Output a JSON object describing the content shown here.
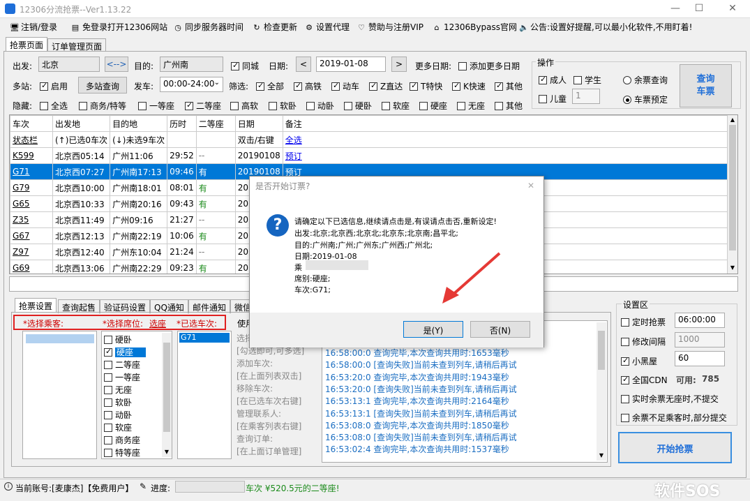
{
  "window": {
    "title": "12306分流抢票--Ver1.13.22",
    "minimize": "—",
    "maximize": "☐",
    "close": "✕"
  },
  "menu": [
    {
      "icon": "🖥",
      "label": "注销/登录"
    },
    {
      "icon": "▤",
      "label": "免登录打开12306网站"
    },
    {
      "icon": "◷",
      "label": "同步服务器时间"
    },
    {
      "icon": "↻",
      "label": "检查更新"
    },
    {
      "icon": "⚙",
      "label": "设置代理"
    },
    {
      "icon": "♡",
      "label": "赞助与注册VIP"
    },
    {
      "icon": "⌂",
      "label": "12306Bypass官网"
    },
    {
      "icon": "🔈",
      "label": "公告:设置好提醒,可以最小化软件,不用盯着!"
    }
  ],
  "tabs": {
    "main": "抢票页面",
    "orders": "订单管理页面"
  },
  "query": {
    "from_label": "出发:",
    "from_value": "北京",
    "swap": "<-->",
    "to_label": "目的:",
    "to_value": "广州南",
    "same_city": "同城",
    "date_label": "日期:",
    "date_value": "2019-01-08",
    "prev": "<",
    "next": ">",
    "more_dates_label": "更多日期:",
    "add_dates": "添加更多日期",
    "multi_label": "多站:",
    "enable": "启用",
    "multi_query": "多站查询",
    "depart_label": "发车:",
    "depart_value": "00:00-24:00",
    "filter_label": "筛选:",
    "filters": [
      "全部",
      "高铁",
      "动车",
      "Z直达",
      "T特快",
      "K快速",
      "其他"
    ],
    "hide_label": "隐藏:",
    "hides": [
      "全选",
      "商务/特等",
      "一等座",
      "二等座",
      "高软",
      "软卧",
      "动卧",
      "硬卧",
      "软座",
      "硬座",
      "无座",
      "其他"
    ]
  },
  "ops": {
    "title": "操作",
    "adult": "成人",
    "student": "学生",
    "child": "儿童",
    "child_count": "1",
    "remain_query": "余票查询",
    "ticket_book": "车票预定",
    "query_btn": "查询\n车票"
  },
  "grid": {
    "headers": [
      "车次",
      "出发地",
      "目的地",
      "历时",
      "二等座",
      "日期",
      "备注"
    ],
    "subheaders": [
      "状态栏",
      "(↑)已选0车次",
      "(↓)未选9车次",
      "",
      "",
      "双击/右键",
      "全选"
    ],
    "rows": [
      {
        "train": "K599",
        "from": "北京西05:14",
        "to": "广州11:06",
        "dur": "29:52",
        "seat": "--",
        "date": "20190108",
        "note": "预订"
      },
      {
        "train": "G71",
        "from": "北京西07:27",
        "to": "广州南17:13",
        "dur": "09:46",
        "seat": "有",
        "date": "20190108",
        "note": "预订"
      },
      {
        "train": "G79",
        "from": "北京西10:00",
        "to": "广州南18:01",
        "dur": "08:01",
        "seat": "有",
        "date": "2019",
        "note": ""
      },
      {
        "train": "G65",
        "from": "北京西10:33",
        "to": "广州南20:16",
        "dur": "09:43",
        "seat": "有",
        "date": "2019",
        "note": ""
      },
      {
        "train": "Z35",
        "from": "北京西11:49",
        "to": "广州09:16",
        "dur": "21:27",
        "seat": "--",
        "date": "2019",
        "note": ""
      },
      {
        "train": "G67",
        "from": "北京西12:13",
        "to": "广州南22:19",
        "dur": "10:06",
        "seat": "有",
        "date": "2019",
        "note": ""
      },
      {
        "train": "Z97",
        "from": "北京西12:40",
        "to": "广州东10:04",
        "dur": "21:24",
        "seat": "--",
        "date": "2019",
        "note": ""
      },
      {
        "train": "G69",
        "from": "北京西13:06",
        "to": "广州南22:29",
        "dur": "09:23",
        "seat": "有",
        "date": "2019",
        "note": ""
      }
    ]
  },
  "bottom_tabs": [
    "抢票设置",
    "查询起售",
    "验证码设置",
    "QQ通知",
    "邮件通知",
    "微信"
  ],
  "passenger": {
    "label": "*选择乘客:",
    "seat_label": "*选择席位:",
    "seat_link": "选座",
    "trains_label": "*已选车次:",
    "use_label": "使用"
  },
  "seats": [
    "硬卧",
    "硬座",
    "二等座",
    "一等座",
    "无座",
    "软卧",
    "动卧",
    "软座",
    "商务座",
    "特等座"
  ],
  "selected_trains": [
    "G71"
  ],
  "help": [
    "选择",
    "[勾选即可,可多选]",
    "添加车次:",
    "[在上面列表双击]",
    "移除车次:",
    "[在已选车次右键]",
    "管理联系人:",
    "[在乘客列表右键]",
    "查询订单:",
    "[在上面订单管理]"
  ],
  "logs": [
    "16:58:00:0  查询完毕,本次查询共用时:1653毫秒",
    "16:58:00:0  [查询失败]当前未查到列车,请稍后再试",
    "16:53:20:0  查询完毕,本次查询共用时:1943毫秒",
    "16:53:20:0  [查询失败]当前未查到列车,请稍后再试",
    "16:53:13:1  查询完毕,本次查询共用时:2164毫秒",
    "16:53:13:1  [查询失败]当前未查到列车,请稍后再试",
    "16:53:08:0  查询完毕,本次查询共用时:1850毫秒",
    "16:53:08:0  [查询失败]当前未查到列车,请稍后再试",
    "16:53:02:4  查询完毕,本次查询共用时:1537毫秒"
  ],
  "settings": {
    "title": "设置区",
    "timed": "定时抢票",
    "timed_value": "06:00:00",
    "interval": "修改间隔",
    "interval_value": "1000",
    "dark": "小黑屋",
    "dark_value": "60",
    "cdn": "全国CDN",
    "cdn_avail": "可用:",
    "cdn_count": "785",
    "realtime": "实时余票无座时,不提交",
    "partial": "余票不足乘客时,部分提交",
    "start": "开始抢票"
  },
  "dialog": {
    "title": "是否开始订票?",
    "close": "✕",
    "lines": [
      "请确定以下已选信息,继续请点击是,有误请点击否,重新设定!",
      "出发:北京;北京西;北京北;北京东;北京南;昌平北;",
      "目的:广州南;广州;广州东;广州西;广州北;",
      "日期:2019-01-08",
      "乘",
      "席别:硬座;",
      "车次:G71;"
    ],
    "yes": "是(Y)",
    "no": "否(N)"
  },
  "status": {
    "account": "当前账号:[麦康杰]【免费用户】",
    "progress": "进度:",
    "message": "车次 ¥520.5元的二等座!"
  },
  "watermark": "软件SOS"
}
